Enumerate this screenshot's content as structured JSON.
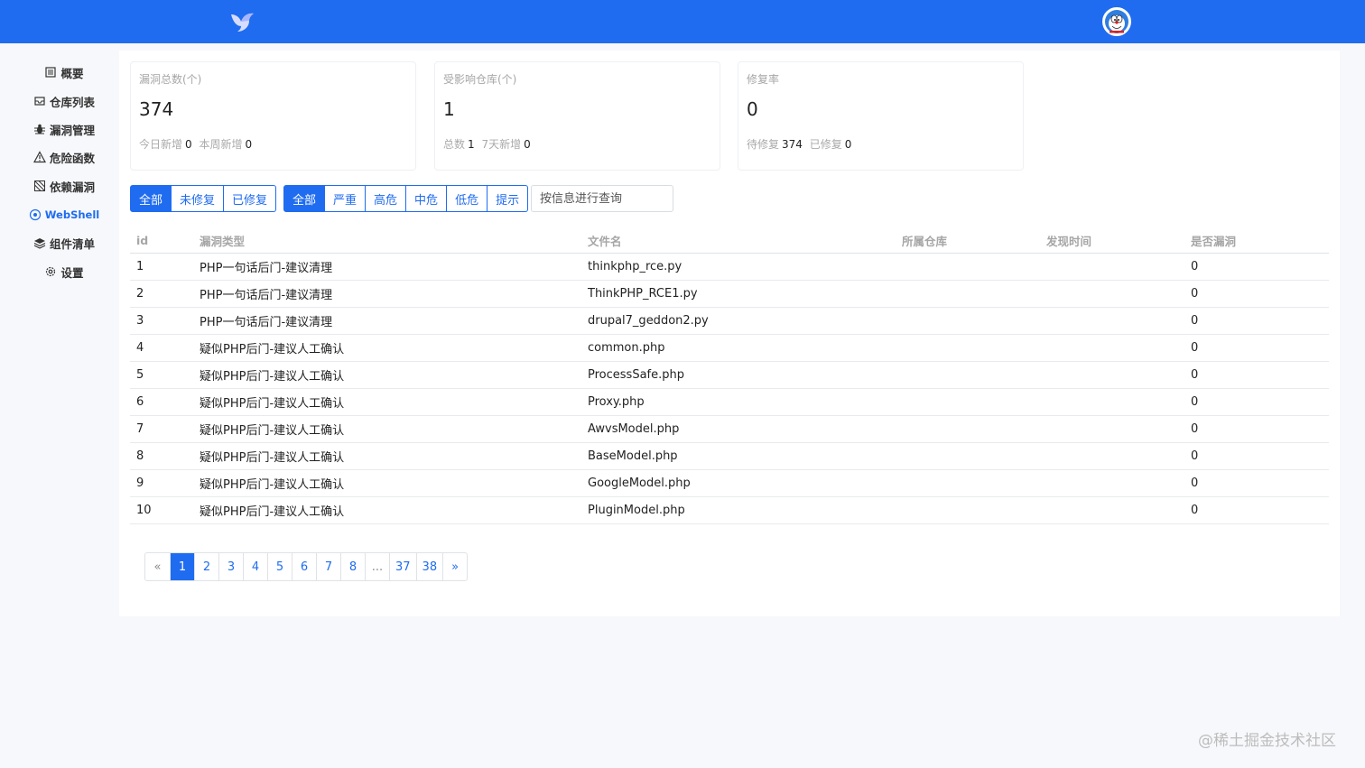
{
  "header": {
    "logo_icon": "bird-icon",
    "avatar_icon": "avatar-icon",
    "brand_color": "#1f6cf0"
  },
  "sidebar": {
    "items": [
      {
        "label": "概要",
        "icon": "list-icon"
      },
      {
        "label": "仓库列表",
        "icon": "inbox-icon"
      },
      {
        "label": "漏洞管理",
        "icon": "bug-icon"
      },
      {
        "label": "危险函数",
        "icon": "warning-icon"
      },
      {
        "label": "依赖漏洞",
        "icon": "dependency-icon"
      },
      {
        "label": "WebShell",
        "icon": "eye-icon",
        "active": true
      },
      {
        "label": "组件清单",
        "icon": "layers-icon"
      },
      {
        "label": "设置",
        "icon": "gear-icon"
      }
    ]
  },
  "cards": [
    {
      "title": "漏洞总数(个)",
      "value": "374",
      "sub1_label": "今日新增",
      "sub1_value": "0",
      "sub2_label": "本周新增",
      "sub2_value": "0"
    },
    {
      "title": "受影响仓库(个)",
      "value": "1",
      "sub1_label": "总数",
      "sub1_value": "1",
      "sub2_label": "7天新增",
      "sub2_value": "0"
    },
    {
      "title": "修复率",
      "value": "0",
      "sub1_label": "待修复",
      "sub1_value": "374",
      "sub2_label": "已修复",
      "sub2_value": "0"
    }
  ],
  "filters": {
    "status": [
      "全部",
      "未修复",
      "已修复"
    ],
    "severity": [
      "全部",
      "严重",
      "高危",
      "中危",
      "低危",
      "提示"
    ],
    "search_placeholder": "按信息进行查询"
  },
  "table": {
    "headers": [
      "id",
      "漏洞类型",
      "文件名",
      "所属仓库",
      "发现时间",
      "是否漏洞"
    ],
    "rows": [
      [
        "1",
        "PHP一句话后门-建议清理",
        "thinkphp_rce.py",
        "",
        "",
        "0"
      ],
      [
        "2",
        "PHP一句话后门-建议清理",
        "ThinkPHP_RCE1.py",
        "",
        "",
        "0"
      ],
      [
        "3",
        "PHP一句话后门-建议清理",
        "drupal7_geddon2.py",
        "",
        "",
        "0"
      ],
      [
        "4",
        "疑似PHP后门-建议人工确认",
        "common.php",
        "",
        "",
        "0"
      ],
      [
        "5",
        "疑似PHP后门-建议人工确认",
        "ProcessSafe.php",
        "",
        "",
        "0"
      ],
      [
        "6",
        "疑似PHP后门-建议人工确认",
        "Proxy.php",
        "",
        "",
        "0"
      ],
      [
        "7",
        "疑似PHP后门-建议人工确认",
        "AwvsModel.php",
        "",
        "",
        "0"
      ],
      [
        "8",
        "疑似PHP后门-建议人工确认",
        "BaseModel.php",
        "",
        "",
        "0"
      ],
      [
        "9",
        "疑似PHP后门-建议人工确认",
        "GoogleModel.php",
        "",
        "",
        "0"
      ],
      [
        "10",
        "疑似PHP后门-建议人工确认",
        "PluginModel.php",
        "",
        "",
        "0"
      ]
    ]
  },
  "pagination": {
    "prev": "«",
    "pages": [
      "1",
      "2",
      "3",
      "4",
      "5",
      "6",
      "7",
      "8",
      "...",
      "37",
      "38"
    ],
    "active": "1",
    "next": "»"
  },
  "watermark": "@稀土掘金技术社区"
}
